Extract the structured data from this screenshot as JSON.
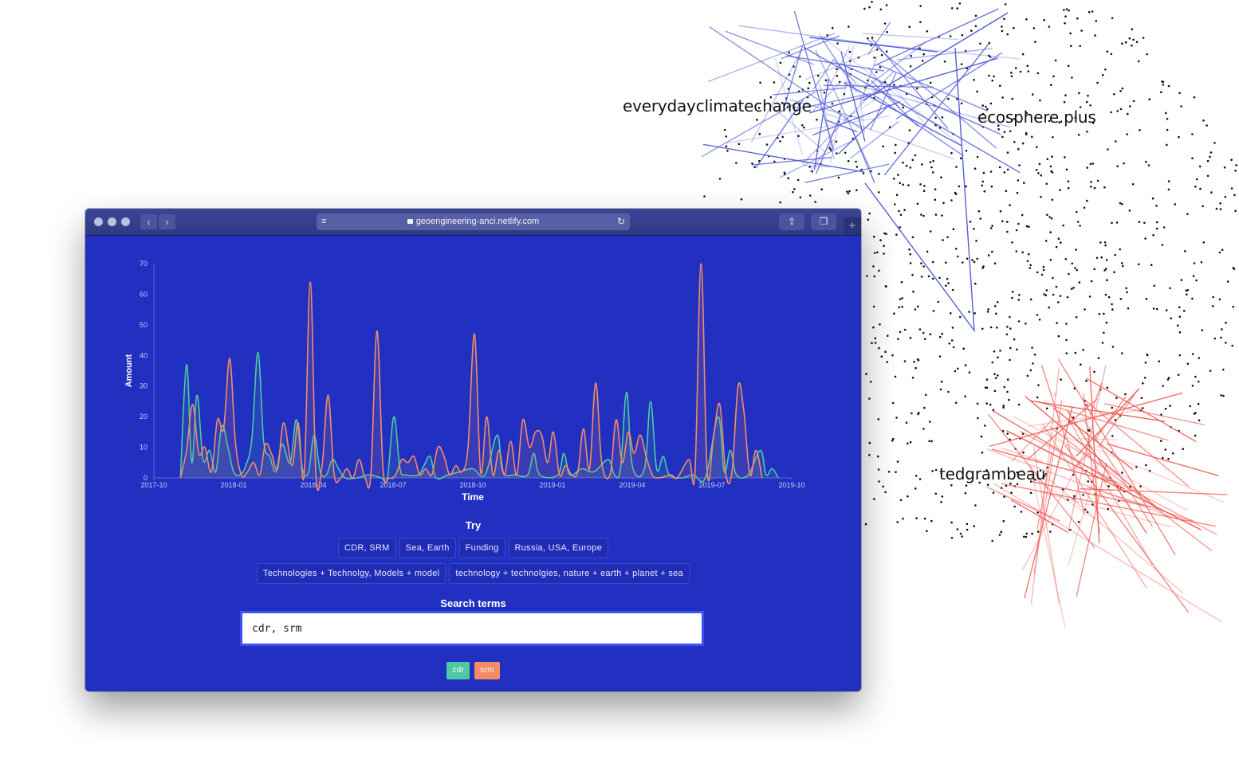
{
  "network": {
    "labels": [
      "everydayclimatechange",
      "ecosphere.plus",
      "tedgrambeau"
    ],
    "colors": {
      "blue_cluster": "#5560d6",
      "red_cluster": "#f0605a",
      "dots": "#111111"
    }
  },
  "browser": {
    "url": "geoengineering-anci.netlify.com",
    "icons": [
      "reader-icon",
      "lock-icon",
      "reload-icon",
      "share-icon",
      "tabs-icon",
      "new-tab-icon"
    ]
  },
  "chart_data": {
    "type": "line",
    "xlabel": "Time",
    "ylabel": "Amount",
    "ylim": [
      0,
      70
    ],
    "yticks": [
      "0",
      "10",
      "20",
      "30",
      "40",
      "50",
      "60",
      "70"
    ],
    "xticks": [
      "2017-10",
      "2018-01",
      "2018-04",
      "2018-07",
      "2018-10",
      "2019-01",
      "2019-04",
      "2019-07",
      "2019-10"
    ],
    "x_range": [
      "2017-10",
      "2019-10"
    ],
    "grid": false,
    "series": [
      {
        "name": "cdr",
        "color": "#4dc9a4",
        "points": [
          [
            "2017-11-01",
            0
          ],
          [
            "2017-11-08",
            37
          ],
          [
            "2017-11-14",
            5
          ],
          [
            "2017-11-20",
            27
          ],
          [
            "2017-11-27",
            6
          ],
          [
            "2017-12-04",
            9
          ],
          [
            "2017-12-11",
            2
          ],
          [
            "2017-12-18",
            17
          ],
          [
            "2017-12-25",
            10
          ],
          [
            "2018-01-01",
            2
          ],
          [
            "2018-01-08",
            1
          ],
          [
            "2018-01-15",
            4
          ],
          [
            "2018-01-22",
            13
          ],
          [
            "2018-01-29",
            41
          ],
          [
            "2018-02-05",
            12
          ],
          [
            "2018-02-12",
            7
          ],
          [
            "2018-02-19",
            2
          ],
          [
            "2018-02-26",
            11
          ],
          [
            "2018-03-05",
            5
          ],
          [
            "2018-03-12",
            19
          ],
          [
            "2018-03-19",
            3
          ],
          [
            "2018-03-26",
            2
          ],
          [
            "2018-04-02",
            14
          ],
          [
            "2018-04-09",
            2
          ],
          [
            "2018-04-16",
            1
          ],
          [
            "2018-04-23",
            6
          ],
          [
            "2018-04-30",
            3
          ],
          [
            "2018-05-07",
            0
          ],
          [
            "2018-05-21",
            0
          ],
          [
            "2018-06-04",
            1
          ],
          [
            "2018-06-18",
            0
          ],
          [
            "2018-06-25",
            0
          ],
          [
            "2018-07-02",
            20
          ],
          [
            "2018-07-09",
            3
          ],
          [
            "2018-07-16",
            1
          ],
          [
            "2018-07-30",
            1
          ],
          [
            "2018-08-06",
            4
          ],
          [
            "2018-08-13",
            7
          ],
          [
            "2018-08-20",
            0
          ],
          [
            "2018-09-03",
            1
          ],
          [
            "2018-09-17",
            2
          ],
          [
            "2018-10-01",
            3
          ],
          [
            "2018-10-15",
            1
          ],
          [
            "2018-10-29",
            14
          ],
          [
            "2018-11-05",
            2
          ],
          [
            "2018-11-19",
            1
          ],
          [
            "2018-12-03",
            1
          ],
          [
            "2018-12-10",
            8
          ],
          [
            "2018-12-17",
            1
          ],
          [
            "2019-01-07",
            1
          ],
          [
            "2019-01-14",
            8
          ],
          [
            "2019-01-21",
            1
          ],
          [
            "2019-02-04",
            3
          ],
          [
            "2019-02-18",
            2
          ],
          [
            "2019-03-04",
            6
          ],
          [
            "2019-03-11",
            1
          ],
          [
            "2019-03-18",
            3
          ],
          [
            "2019-03-25",
            28
          ],
          [
            "2019-04-01",
            4
          ],
          [
            "2019-04-15",
            3
          ],
          [
            "2019-04-22",
            25
          ],
          [
            "2019-04-29",
            3
          ],
          [
            "2019-05-06",
            7
          ],
          [
            "2019-05-13",
            1
          ],
          [
            "2019-05-27",
            0
          ],
          [
            "2019-06-10",
            1
          ],
          [
            "2019-06-24",
            0
          ],
          [
            "2019-07-08",
            20
          ],
          [
            "2019-07-15",
            2
          ],
          [
            "2019-07-22",
            9
          ],
          [
            "2019-07-29",
            1
          ],
          [
            "2019-08-12",
            1
          ],
          [
            "2019-08-26",
            9
          ],
          [
            "2019-09-02",
            1
          ],
          [
            "2019-09-09",
            3
          ],
          [
            "2019-09-16",
            0
          ]
        ]
      },
      {
        "name": "srm",
        "color": "#f28c68",
        "points": [
          [
            "2017-11-01",
            0
          ],
          [
            "2017-11-08",
            9
          ],
          [
            "2017-11-15",
            24
          ],
          [
            "2017-11-22",
            8
          ],
          [
            "2017-11-29",
            10
          ],
          [
            "2017-12-06",
            2
          ],
          [
            "2017-12-13",
            19
          ],
          [
            "2017-12-20",
            16
          ],
          [
            "2017-12-27",
            39
          ],
          [
            "2018-01-03",
            12
          ],
          [
            "2018-01-10",
            1
          ],
          [
            "2018-01-17",
            2
          ],
          [
            "2018-01-24",
            5
          ],
          [
            "2018-01-31",
            1
          ],
          [
            "2018-02-07",
            11
          ],
          [
            "2018-02-14",
            8
          ],
          [
            "2018-02-21",
            3
          ],
          [
            "2018-02-28",
            18
          ],
          [
            "2018-03-07",
            4
          ],
          [
            "2018-03-14",
            18
          ],
          [
            "2018-03-21",
            1
          ],
          [
            "2018-03-28",
            64
          ],
          [
            "2018-04-04",
            1
          ],
          [
            "2018-04-11",
            4
          ],
          [
            "2018-04-18",
            27
          ],
          [
            "2018-04-25",
            1
          ],
          [
            "2018-05-02",
            0
          ],
          [
            "2018-05-09",
            3
          ],
          [
            "2018-05-16",
            0
          ],
          [
            "2018-05-23",
            6
          ],
          [
            "2018-05-30",
            0
          ],
          [
            "2018-06-06",
            1
          ],
          [
            "2018-06-13",
            48
          ],
          [
            "2018-06-20",
            3
          ],
          [
            "2018-06-27",
            0
          ],
          [
            "2018-07-04",
            1
          ],
          [
            "2018-07-11",
            6
          ],
          [
            "2018-07-18",
            5
          ],
          [
            "2018-07-25",
            7
          ],
          [
            "2018-08-01",
            1
          ],
          [
            "2018-08-08",
            3
          ],
          [
            "2018-08-15",
            1
          ],
          [
            "2018-08-22",
            10
          ],
          [
            "2018-08-29",
            7
          ],
          [
            "2018-09-05",
            1
          ],
          [
            "2018-09-12",
            4
          ],
          [
            "2018-09-19",
            2
          ],
          [
            "2018-09-26",
            10
          ],
          [
            "2018-10-03",
            47
          ],
          [
            "2018-10-10",
            2
          ],
          [
            "2018-10-17",
            20
          ],
          [
            "2018-10-24",
            1
          ],
          [
            "2018-10-31",
            9
          ],
          [
            "2018-11-07",
            1
          ],
          [
            "2018-11-14",
            12
          ],
          [
            "2018-11-21",
            1
          ],
          [
            "2018-11-28",
            19
          ],
          [
            "2018-12-05",
            10
          ],
          [
            "2018-12-12",
            15
          ],
          [
            "2018-12-19",
            14
          ],
          [
            "2018-12-26",
            5
          ],
          [
            "2019-01-02",
            15
          ],
          [
            "2019-01-09",
            1
          ],
          [
            "2019-01-16",
            4
          ],
          [
            "2019-01-23",
            1
          ],
          [
            "2019-01-30",
            2
          ],
          [
            "2019-02-06",
            16
          ],
          [
            "2019-02-13",
            3
          ],
          [
            "2019-02-20",
            31
          ],
          [
            "2019-02-27",
            5
          ],
          [
            "2019-03-06",
            1
          ],
          [
            "2019-03-13",
            19
          ],
          [
            "2019-03-20",
            5
          ],
          [
            "2019-03-27",
            15
          ],
          [
            "2019-04-03",
            8
          ],
          [
            "2019-04-10",
            14
          ],
          [
            "2019-04-17",
            7
          ],
          [
            "2019-04-24",
            1
          ],
          [
            "2019-05-01",
            0
          ],
          [
            "2019-05-15",
            1
          ],
          [
            "2019-05-22",
            0
          ],
          [
            "2019-06-05",
            6
          ],
          [
            "2019-06-12",
            2
          ],
          [
            "2019-06-19",
            70
          ],
          [
            "2019-06-26",
            2
          ],
          [
            "2019-07-03",
            14
          ],
          [
            "2019-07-10",
            24
          ],
          [
            "2019-07-17",
            1
          ],
          [
            "2019-07-24",
            2
          ],
          [
            "2019-07-31",
            30
          ],
          [
            "2019-08-07",
            22
          ],
          [
            "2019-08-14",
            1
          ],
          [
            "2019-08-21",
            9
          ],
          [
            "2019-08-28",
            0
          ]
        ]
      }
    ]
  },
  "try_section": {
    "title": "Try",
    "row1": [
      "CDR, SRM",
      "Sea, Earth",
      "Funding",
      "Russia, USA, Europe"
    ],
    "row2": [
      "Technologies + Technolgy, Models + model",
      "technology + technolgies, nature + earth + planet + sea"
    ]
  },
  "search": {
    "label": "Search terms",
    "value": "cdr, srm"
  },
  "tags": [
    {
      "label": "cdr",
      "color": "#4dc9a4"
    },
    {
      "label": "srm",
      "color": "#f28c68"
    }
  ]
}
